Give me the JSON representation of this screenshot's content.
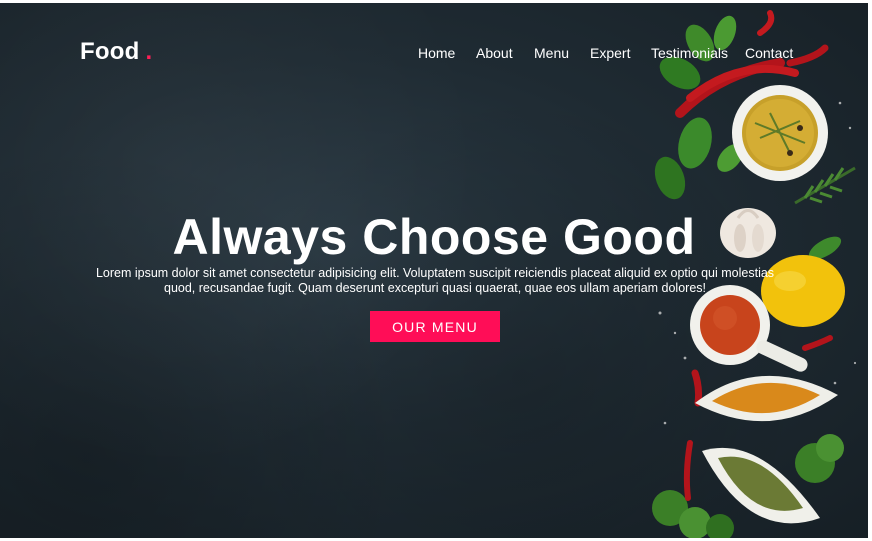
{
  "brand": {
    "name": "Food",
    "dot": "."
  },
  "nav": {
    "items": [
      {
        "label": "Home"
      },
      {
        "label": "About"
      },
      {
        "label": "Menu"
      },
      {
        "label": "Expert"
      },
      {
        "label": "Testimonials"
      },
      {
        "label": "Contact"
      }
    ]
  },
  "hero": {
    "title": "Always Choose Good",
    "text": "Lorem ipsum dolor sit amet consectetur adipisicing elit. Voluptatem suscipit reiciendis placeat aliquid ex optio qui molestias quod, recusandae fugit. Quam deserunt excepturi quasi quaerat, quae eos ullam aperiam dolores!",
    "cta_label": "OUR MENU"
  },
  "colors": {
    "accent": "#ff0d57",
    "background": "#1f2b33",
    "text": "#ffffff"
  }
}
